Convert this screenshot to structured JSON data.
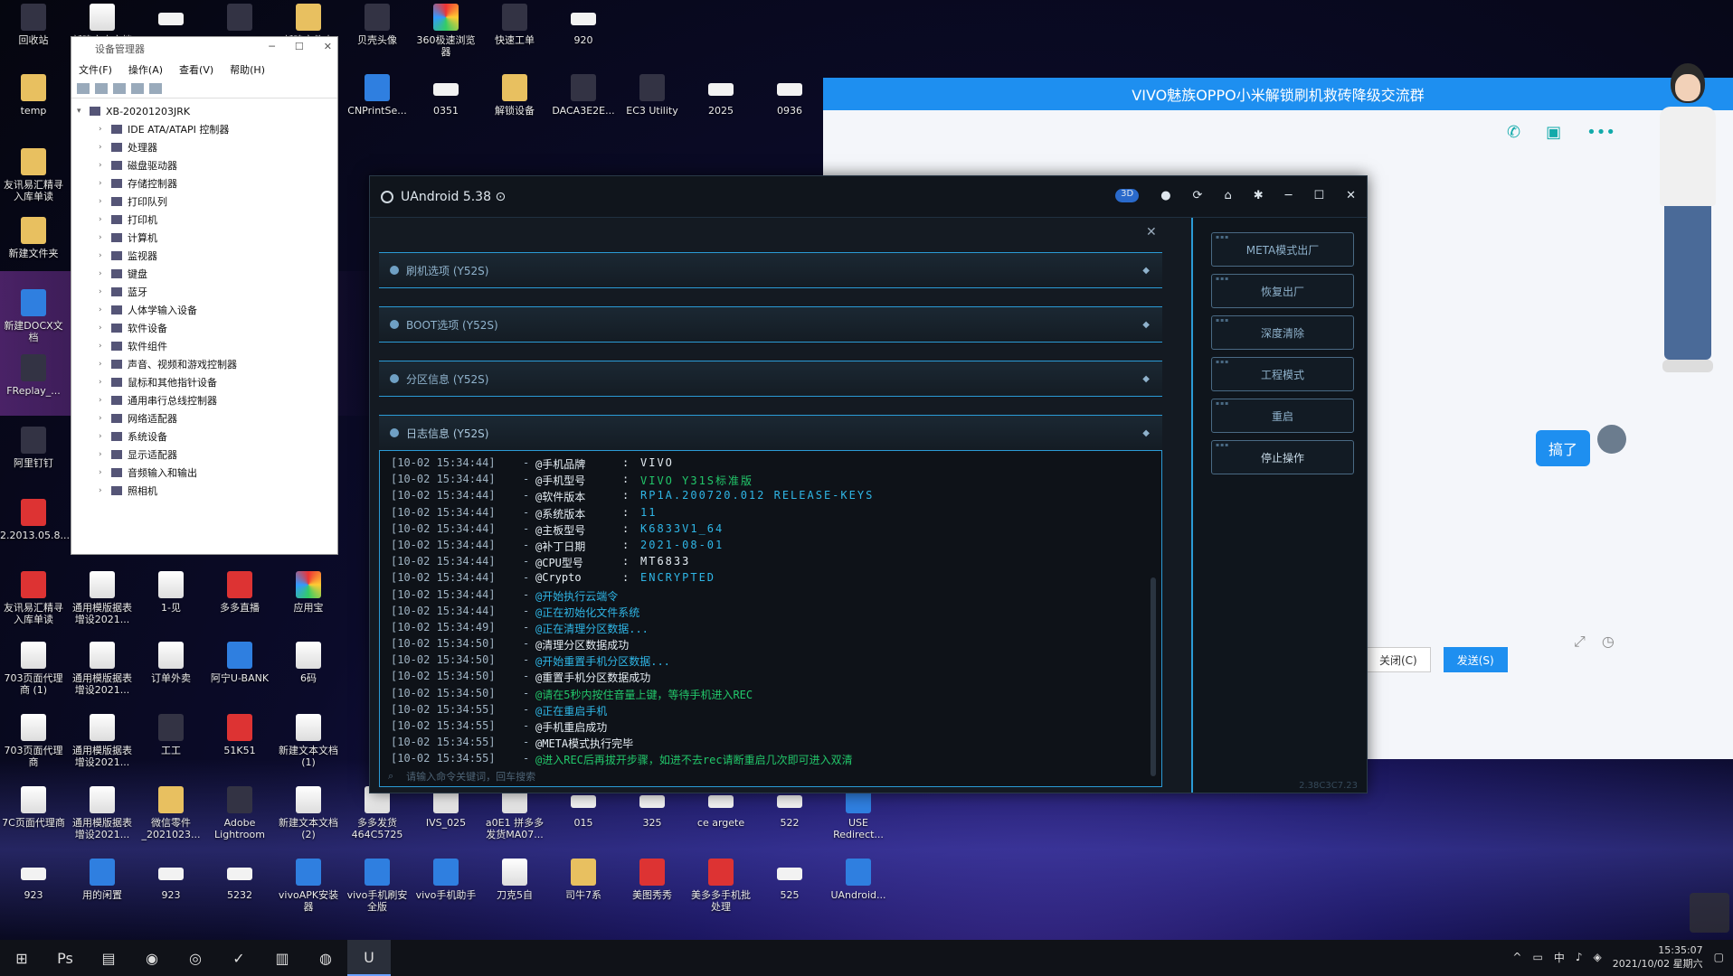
{
  "desktop": {
    "icons": [
      {
        "label": "回收站",
        "x": 0,
        "y": 0
      },
      {
        "label": "新建文本文档",
        "x": 0,
        "y": 0
      },
      {
        "label": "305",
        "x": 0,
        "y": 0
      },
      {
        "label": "CDS Studio",
        "x": 0,
        "y": 0
      },
      {
        "label": "新建文件夹 (2)",
        "x": 0,
        "y": 0
      },
      {
        "label": "贝壳头像",
        "x": 0,
        "y": 0
      },
      {
        "label": "360极速浏览器",
        "x": 0,
        "y": 0
      },
      {
        "label": "快速工单",
        "x": 0,
        "y": 0
      },
      {
        "label": "920",
        "x": 0,
        "y": 0
      },
      {
        "label": "temp",
        "x": 0,
        "y": 0
      },
      {
        "label": "CNPrintSe...",
        "x": 0,
        "y": 0
      },
      {
        "label": "0351",
        "x": 0,
        "y": 0
      },
      {
        "label": "解锁设备",
        "x": 0,
        "y": 0
      },
      {
        "label": "DACA3E2E...",
        "x": 0,
        "y": 0
      },
      {
        "label": "EC3 Utility",
        "x": 0,
        "y": 0
      },
      {
        "label": "2025",
        "x": 0,
        "y": 0
      },
      {
        "label": "0936",
        "x": 0,
        "y": 0
      },
      {
        "label": "友讯易汇精寻入库单读",
        "x": 0,
        "y": 0
      },
      {
        "label": "新建文件夹",
        "x": 0,
        "y": 0
      },
      {
        "label": "新建DOCX文档",
        "x": 0,
        "y": 0
      },
      {
        "label": "FReplay_...",
        "x": 0,
        "y": 0
      },
      {
        "label": "阿里钉钉",
        "x": 0,
        "y": 0
      },
      {
        "label": "2.2013.05.8...",
        "x": 0,
        "y": 0
      },
      {
        "label": "友讯易汇精寻入库单读",
        "x": 0,
        "y": 0
      },
      {
        "label": "通用模版据表增设2021...",
        "x": 0,
        "y": 0
      },
      {
        "label": "1-见",
        "x": 0,
        "y": 0
      },
      {
        "label": "多多直播",
        "x": 0,
        "y": 0
      },
      {
        "label": "应用宝",
        "x": 0,
        "y": 0
      },
      {
        "label": "703页面代理商 (1)",
        "x": 0,
        "y": 0
      },
      {
        "label": "通用模版据表增设2021...",
        "x": 0,
        "y": 0
      },
      {
        "label": "订单外卖",
        "x": 0,
        "y": 0
      },
      {
        "label": "阿宁U-BANK",
        "x": 0,
        "y": 0
      },
      {
        "label": "6码",
        "x": 0,
        "y": 0
      },
      {
        "label": "703页面代理商",
        "x": 0,
        "y": 0
      },
      {
        "label": "通用模版据表增设2021...",
        "x": 0,
        "y": 0
      },
      {
        "label": "工工",
        "x": 0,
        "y": 0
      },
      {
        "label": "51K51",
        "x": 0,
        "y": 0
      },
      {
        "label": "新建文本文档 (1)",
        "x": 0,
        "y": 0
      },
      {
        "label": "7C页面代理商",
        "x": 0,
        "y": 0
      },
      {
        "label": "通用模版据表增设2021...",
        "x": 0,
        "y": 0
      },
      {
        "label": "微信零件_2021023...",
        "x": 0,
        "y": 0
      },
      {
        "label": "Adobe Lightroom",
        "x": 0,
        "y": 0
      },
      {
        "label": "新建文本文档 (2)",
        "x": 0,
        "y": 0
      },
      {
        "label": "多多发货464C5725",
        "x": 0,
        "y": 0
      },
      {
        "label": "IVS_025",
        "x": 0,
        "y": 0
      },
      {
        "label": "a0E1 拼多多发货MA07...",
        "x": 0,
        "y": 0
      },
      {
        "label": "015",
        "x": 0,
        "y": 0
      },
      {
        "label": "325",
        "x": 0,
        "y": 0
      },
      {
        "label": "ce argete",
        "x": 0,
        "y": 0
      },
      {
        "label": "522",
        "x": 0,
        "y": 0
      },
      {
        "label": "USE Redirect...",
        "x": 0,
        "y": 0
      },
      {
        "label": "923",
        "x": 0,
        "y": 0
      },
      {
        "label": "用的闲置",
        "x": 0,
        "y": 0
      },
      {
        "label": "923",
        "x": 0,
        "y": 0
      },
      {
        "label": "5232",
        "x": 0,
        "y": 0
      },
      {
        "label": "vivoAPK安装器",
        "x": 0,
        "y": 0
      },
      {
        "label": "vivo手机刷安全版",
        "x": 0,
        "y": 0
      },
      {
        "label": "vivo手机助手",
        "x": 0,
        "y": 0
      },
      {
        "label": "刀克5自",
        "x": 0,
        "y": 0
      },
      {
        "label": "司牛7系",
        "x": 0,
        "y": 0
      },
      {
        "label": "美图秀秀",
        "x": 0,
        "y": 0
      },
      {
        "label": "美多多手机批处理",
        "x": 0,
        "y": 0
      },
      {
        "label": "525",
        "x": 0,
        "y": 0
      },
      {
        "label": "UAndroid...",
        "x": 0,
        "y": 0
      }
    ]
  },
  "device_manager": {
    "title": "设备管理器",
    "menu": [
      "文件(F)",
      "操作(A)",
      "查看(V)",
      "帮助(H)"
    ],
    "root": "XB-20201203JRK",
    "items": [
      "IDE ATA/ATAPI 控制器",
      "处理器",
      "磁盘驱动器",
      "存储控制器",
      "打印队列",
      "打印机",
      "计算机",
      "监视器",
      "键盘",
      "蓝牙",
      "人体学输入设备",
      "软件设备",
      "软件组件",
      "声音、视频和游戏控制器",
      "鼠标和其他指针设备",
      "通用串行总线控制器",
      "网络适配器",
      "系统设备",
      "显示适配器",
      "音频输入和输出",
      "照相机"
    ]
  },
  "chat": {
    "title": "VIVO魅族OPPO小米解锁刷机救砖降级交流群",
    "message": "搞了",
    "close_label": "关闭(C)",
    "send_label": "发送(S)"
  },
  "uandroid": {
    "title": "UAndroid 5.38 ⊙",
    "badge": "3D",
    "sections": [
      "刷机选项 (Y52S)",
      "BOOT选项 (Y52S)",
      "分区信息 (Y52S)",
      "日志信息 (Y52S)"
    ],
    "side_buttons": [
      "META模式出厂",
      "恢复出厂",
      "深度清除",
      "工程模式",
      "重启",
      "停止操作"
    ],
    "search_placeholder": "请输入命令关键词，回车搜索",
    "version_footer": "2.38C3C7.23",
    "log": [
      {
        "ts": "[10-02 15:34:44]",
        "label": "@手机品牌",
        "sep": ":",
        "value": "VIVO",
        "color": "white"
      },
      {
        "ts": "[10-02 15:34:44]",
        "label": "@手机型号",
        "sep": ":",
        "value": "VIVO Y31S标准版",
        "color": "green"
      },
      {
        "ts": "[10-02 15:34:44]",
        "label": "@软件版本",
        "sep": ":",
        "value": "RP1A.200720.012 RELEASE-KEYS",
        "color": "cyan"
      },
      {
        "ts": "[10-02 15:34:44]",
        "label": "@系统版本",
        "sep": ":",
        "value": "11",
        "color": "cyan"
      },
      {
        "ts": "[10-02 15:34:44]",
        "label": "@主板型号",
        "sep": ":",
        "value": "K6833V1_64",
        "color": "cyan"
      },
      {
        "ts": "[10-02 15:34:44]",
        "label": "@补丁日期",
        "sep": ":",
        "value": "2021-08-01",
        "color": "cyan"
      },
      {
        "ts": "[10-02 15:34:44]",
        "label": "@CPU型号",
        "sep": ":",
        "value": "MT6833",
        "color": "white"
      },
      {
        "ts": "[10-02 15:34:44]",
        "label": "@Crypto",
        "sep": ":",
        "value": "ENCRYPTED",
        "color": "cyan"
      },
      {
        "ts": "[10-02 15:34:44]",
        "label": "@开始执行云端令",
        "sep": "",
        "value": "",
        "color": "cyan"
      },
      {
        "ts": "[10-02 15:34:44]",
        "label": "@正在初始化文件系统",
        "sep": "",
        "value": "",
        "color": "cyan"
      },
      {
        "ts": "[10-02 15:34:49]",
        "label": "@正在清理分区数据...",
        "sep": "",
        "value": "",
        "color": "cyan"
      },
      {
        "ts": "[10-02 15:34:50]",
        "label": "@清理分区数据成功",
        "sep": "",
        "value": "",
        "color": "white"
      },
      {
        "ts": "[10-02 15:34:50]",
        "label": "@开始重置手机分区数据...",
        "sep": "",
        "value": "",
        "color": "cyan"
      },
      {
        "ts": "[10-02 15:34:50]",
        "label": "@重置手机分区数据成功",
        "sep": "",
        "value": "",
        "color": "white"
      },
      {
        "ts": "[10-02 15:34:50]",
        "label": "@请在5秒内按住音量上键，等待手机进入REC",
        "sep": "",
        "value": "",
        "color": "green"
      },
      {
        "ts": "[10-02 15:34:55]",
        "label": "@正在重启手机",
        "sep": "",
        "value": "",
        "color": "cyan"
      },
      {
        "ts": "[10-02 15:34:55]",
        "label": "@手机重启成功",
        "sep": "",
        "value": "",
        "color": "white"
      },
      {
        "ts": "[10-02 15:34:55]",
        "label": "@META模式执行完毕",
        "sep": "",
        "value": "",
        "color": "white"
      },
      {
        "ts": "[10-02 15:34:55]",
        "label": "@进入REC后再拔开步骤，如进不去rec请断重启几次即可进入双清",
        "sep": "",
        "value": "",
        "color": "green"
      }
    ]
  },
  "taskbar": {
    "time": "15:35:07",
    "date": "2021/10/02 星期六"
  }
}
